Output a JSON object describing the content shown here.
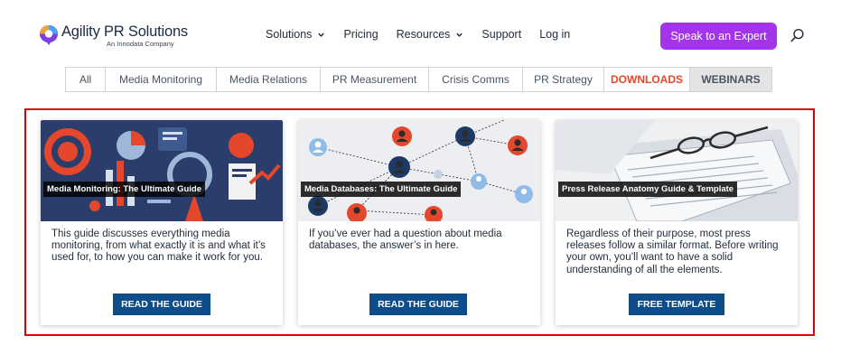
{
  "header": {
    "logo_name": "Agility PR Solutions",
    "logo_sub": "An Innodata Company",
    "nav": [
      {
        "label": "Solutions",
        "dropdown": true
      },
      {
        "label": "Pricing",
        "dropdown": false
      },
      {
        "label": "Resources",
        "dropdown": true
      },
      {
        "label": "Support",
        "dropdown": false
      },
      {
        "label": "Log in",
        "dropdown": false
      }
    ],
    "cta_label": "Speak to an Expert",
    "colors": {
      "cta": "#a334e9",
      "brand_dark": "#1b2a41",
      "brand_accent": "#e4472b"
    }
  },
  "tabs": [
    "All",
    "Media Monitoring",
    "Media Relations",
    "PR Measurement",
    "Crisis Comms",
    "PR Strategy",
    "DOWNLOADS",
    "WEBINARS"
  ],
  "cards": [
    {
      "label": "Media Monitoring: The Ultimate Guide",
      "description": "This guide discusses everything media monitoring, from what exactly it is and what it’s used for, to how you can make it work for you.",
      "button": "READ THE GUIDE"
    },
    {
      "label": "Media Databases: The Ultimate Guide",
      "description": "If you’ve ever had a question about media databases, the answer’s in here.",
      "button": "READ THE GUIDE"
    },
    {
      "label": "Press Release Anatomy Guide & Template",
      "description": "Regardless of their purpose, most press releases follow a similar format. Before writing your own, you’ll want to have a solid understanding of all the elements.",
      "button": "FREE TEMPLATE"
    }
  ],
  "colors": {
    "button": "#0e4c8a",
    "highlight_frame": "#e00000"
  }
}
